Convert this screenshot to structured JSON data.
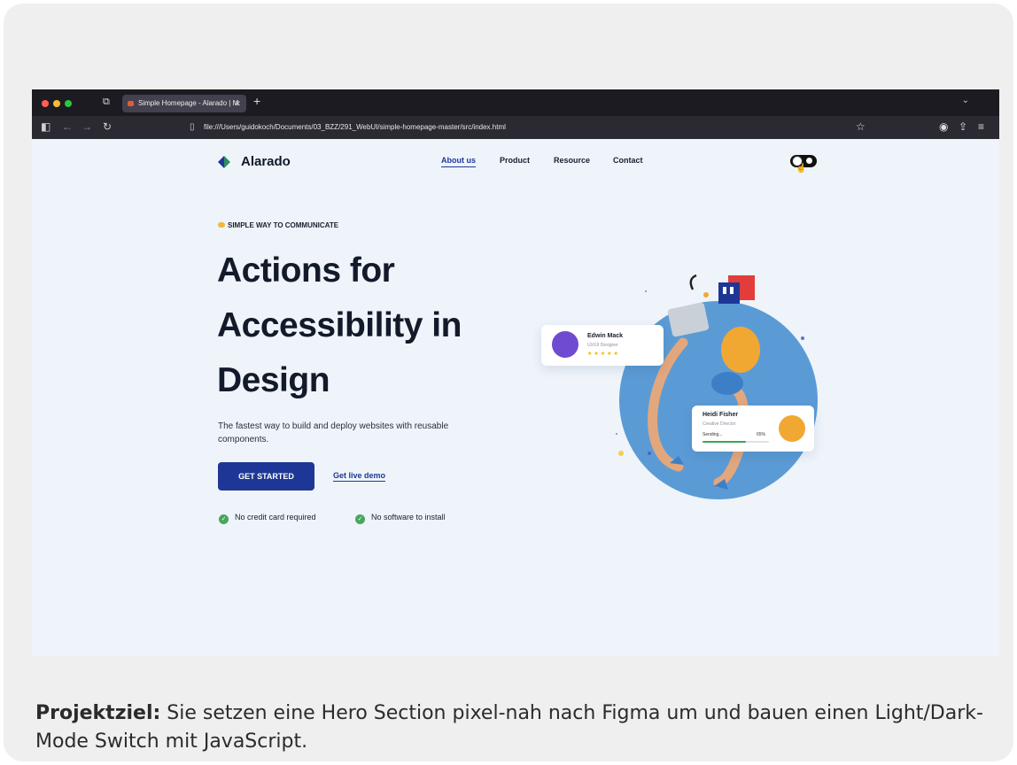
{
  "browser": {
    "tab_title": "Simple Homepage - Alarado | M",
    "tab_close": "✕",
    "new_tab": "+",
    "url": "file:///Users/guidokoch/Documents/03_BZZ/291_WebUI/simple-homepage-master/src/index.html"
  },
  "site": {
    "logo": "Alarado",
    "nav": {
      "about": "About us",
      "product": "Product",
      "resource": "Resource",
      "contact": "Contact"
    },
    "eyebrow": "SIMPLE WAY TO COMMUNICATE",
    "headline": "Actions for Accessibility in Design",
    "description": "The fastest way to build and deploy websites with reusable components.",
    "cta_primary": "GET STARTED",
    "cta_secondary": "Get live demo",
    "checks": [
      "No credit card required",
      "No software to install"
    ],
    "badge1": {
      "name": "Edwin Mack",
      "role": "UX/UI Designer",
      "stars": "★★★★★"
    },
    "badge2": {
      "name": "Heidi Fisher",
      "role": "Creative Director",
      "status": "Sending...",
      "percent": "65%",
      "progress": 0.65
    }
  },
  "caption": {
    "label": "Projektziel:",
    "text": " Sie setzen eine Hero Section pixel-nah nach Figma um und bauen einen Light/Dark-Mode Switch mit JavaScript."
  },
  "colors": {
    "primary": "#1e3796",
    "circle": "#5b9bd5",
    "check": "#4aa55e"
  }
}
